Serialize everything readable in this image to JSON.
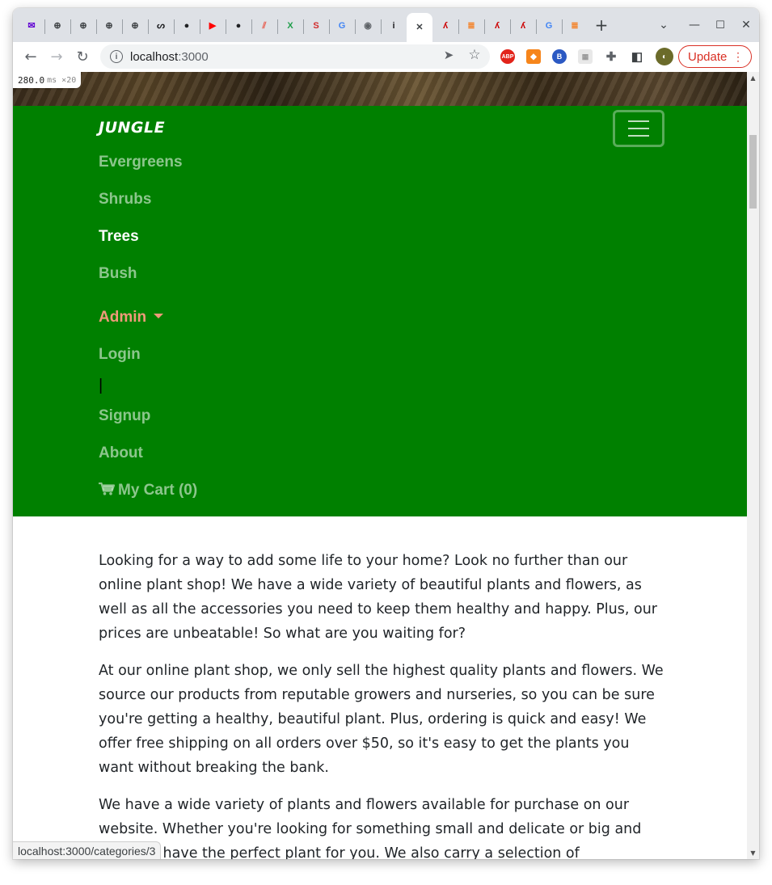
{
  "browser": {
    "tabs": [
      {
        "icon": "mail-icon",
        "glyph": "✉",
        "color": "#6001d2",
        "active": false
      },
      {
        "icon": "circle-plus-icon",
        "glyph": "⊕",
        "color": "#3c4043",
        "active": false
      },
      {
        "icon": "circle-plus-icon",
        "glyph": "⊕",
        "color": "#3c4043",
        "active": false
      },
      {
        "icon": "circle-plus-icon",
        "glyph": "⊕",
        "color": "#3c4043",
        "active": false
      },
      {
        "icon": "circle-plus-icon",
        "glyph": "⊕",
        "color": "#3c4043",
        "active": false
      },
      {
        "icon": "swirl-icon",
        "glyph": "ᔕ",
        "color": "#202124",
        "active": false
      },
      {
        "icon": "github-icon",
        "glyph": "●",
        "color": "#202124",
        "active": false
      },
      {
        "icon": "youtube-icon",
        "glyph": "▶",
        "color": "#ff0000",
        "active": false
      },
      {
        "icon": "github-icon",
        "glyph": "●",
        "color": "#202124",
        "active": false
      },
      {
        "icon": "stripes-icon",
        "glyph": "⫽",
        "color": "#e8594a",
        "active": false
      },
      {
        "icon": "x-icon",
        "glyph": "X",
        "color": "#1e9e4a",
        "active": false
      },
      {
        "icon": "s-icon",
        "glyph": "S",
        "color": "#d22c2c",
        "active": false
      },
      {
        "icon": "google-icon",
        "glyph": "G",
        "color": "#4285f4",
        "active": false
      },
      {
        "icon": "globe-icon",
        "glyph": "◉",
        "color": "#5f6368",
        "active": false
      },
      {
        "icon": "info-icon",
        "glyph": "i",
        "color": "#202124",
        "active": false
      },
      {
        "icon": "close-icon",
        "glyph": "✕",
        "color": "#3c4043",
        "active": true
      },
      {
        "icon": "rails-icon",
        "glyph": "ʎ",
        "color": "#cc0000",
        "active": false
      },
      {
        "icon": "stack-overflow-icon",
        "glyph": "≣",
        "color": "#f48024",
        "active": false
      },
      {
        "icon": "rails-icon",
        "glyph": "ʎ",
        "color": "#cc0000",
        "active": false
      },
      {
        "icon": "rails-icon",
        "glyph": "ʎ",
        "color": "#cc0000",
        "active": false
      },
      {
        "icon": "google-icon",
        "glyph": "G",
        "color": "#4285f4",
        "active": false
      },
      {
        "icon": "stack-overflow-icon",
        "glyph": "≣",
        "color": "#f48024",
        "active": false
      }
    ],
    "new_tab_glyph": "+",
    "url_host": "localhost",
    "url_port": ":3000",
    "update_label": "Update",
    "perf_value": "280.0",
    "perf_unit": "ms ×20",
    "status_url": "localhost:3000/categories/3"
  },
  "navbar": {
    "brand": "JUNGLE",
    "links": [
      {
        "label": "Evergreens",
        "state": "normal"
      },
      {
        "label": "Shrubs",
        "state": "normal"
      },
      {
        "label": "Trees",
        "state": "active"
      },
      {
        "label": "Bush",
        "state": "normal"
      }
    ],
    "admin_label": "Admin",
    "login_label": "Login",
    "separator": "|",
    "signup_label": "Signup",
    "about_label": "About",
    "cart_label": "My Cart (0)",
    "colors": {
      "background": "#008000",
      "admin": "#f09a7a"
    }
  },
  "content": {
    "paragraphs": [
      "Looking for a way to add some life to your home? Look no further than our online plant shop! We have a wide variety of beautiful plants and flowers, as well as all the accessories you need to keep them healthy and happy. Plus, our prices are unbeatable! So what are you waiting for?",
      "At our online plant shop, we only sell the highest quality plants and flowers. We source our products from reputable growers and nurseries, so you can be sure you're getting a healthy, beautiful plant. Plus, ordering is quick and easy! We offer free shipping on all orders over $50, so it's easy to get the plants you want without breaking the bank.",
      "We have a wide variety of plants and flowers available for purchase on our website. Whether you're looking for something small and delicate or big and bold, we have the perfect plant for you. We also carry a selection of accessories, including potting soil, planters, and more."
    ]
  }
}
